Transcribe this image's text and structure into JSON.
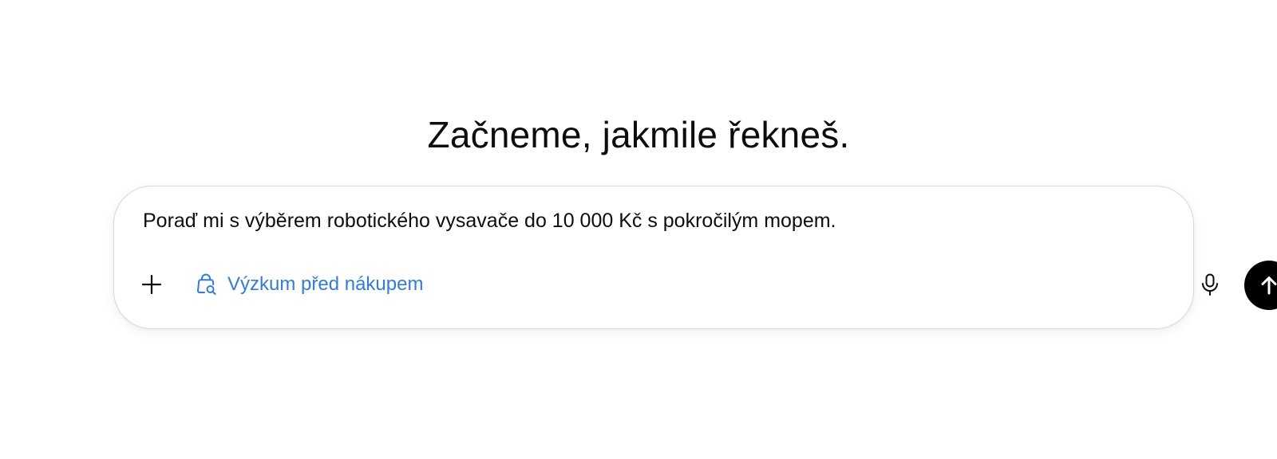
{
  "main": {
    "heading": "Začneme, jakmile řekneš."
  },
  "composer": {
    "input_value": "Poraď mi s výběrem robotického vysavače do 10 000 Kč s pokročilým mopem.",
    "tool_chip": {
      "label": "Výzkum před nákupem",
      "icon": "shopping-bag-search-icon",
      "color": "#2f7bea"
    },
    "icons": {
      "add": "plus-icon",
      "voice": "microphone-icon",
      "send": "arrow-up-icon"
    },
    "send_button_color": "#000000"
  }
}
